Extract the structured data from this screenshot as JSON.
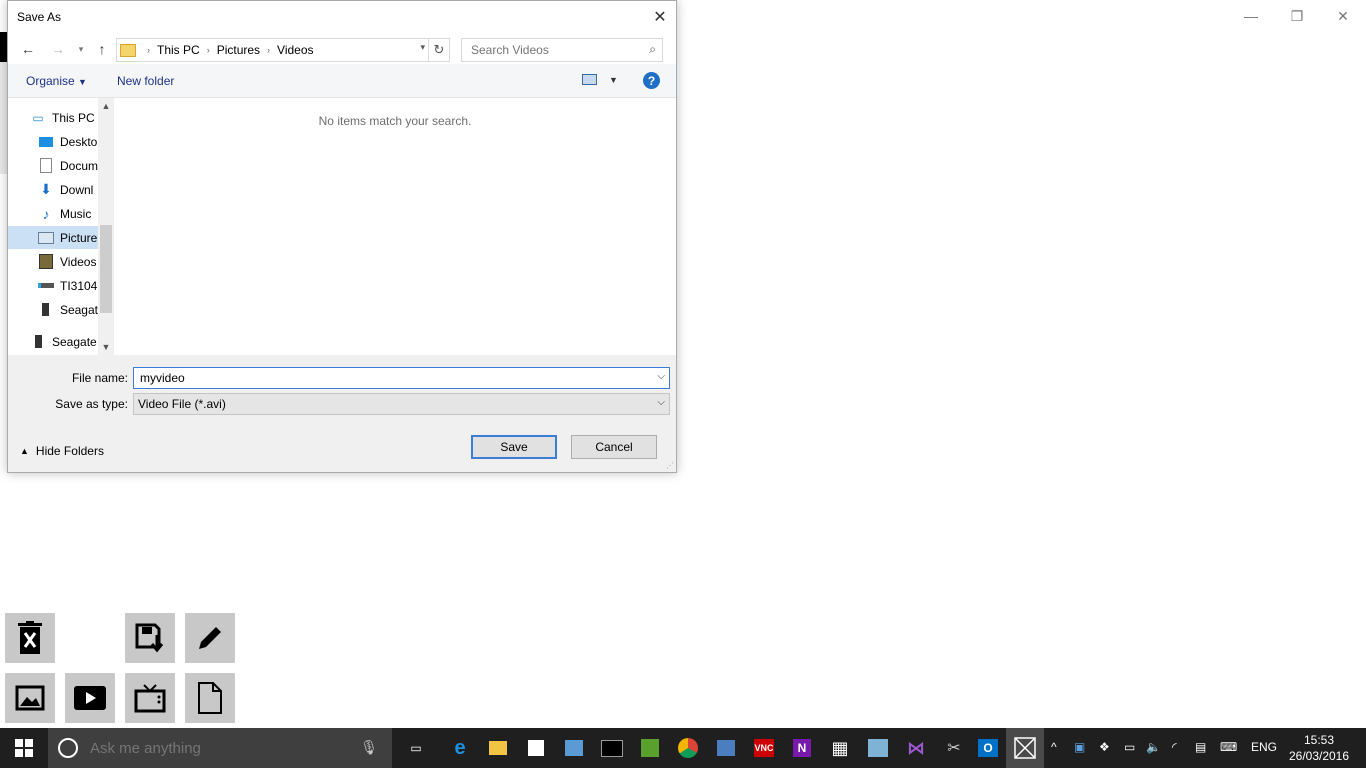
{
  "dialog": {
    "title": "Save As",
    "breadcrumb": [
      "This PC",
      "Pictures",
      "Videos"
    ],
    "search_placeholder": "Search Videos",
    "toolbar": {
      "organise": "Organise",
      "new_folder": "New folder"
    },
    "nav_items": [
      {
        "label": "This PC",
        "icon": "computer-icon"
      },
      {
        "label": "Deskto",
        "icon": "desktop-icon"
      },
      {
        "label": "Docum",
        "icon": "documents-icon"
      },
      {
        "label": "Downl",
        "icon": "downloads-icon"
      },
      {
        "label": "Music",
        "icon": "music-icon"
      },
      {
        "label": "Picture",
        "icon": "pictures-icon",
        "selected": true
      },
      {
        "label": "Videos",
        "icon": "videos-icon"
      },
      {
        "label": "TI3104",
        "icon": "drive-icon"
      },
      {
        "label": "Seagat",
        "icon": "external-drive-icon"
      },
      {
        "label": "Seagate",
        "icon": "external-drive-icon"
      }
    ],
    "empty_message": "No items match your search.",
    "file_name_label": "File name:",
    "file_name_value": "myvideo",
    "save_type_label": "Save as type:",
    "save_type_value": "Video File (*.avi)",
    "hide_folders": "Hide Folders",
    "save_button": "Save",
    "cancel_button": "Cancel"
  },
  "tool_tiles": [
    "delete-icon",
    "save-download-icon",
    "pencil-icon",
    "image-icon",
    "play-video-icon",
    "tv-icon",
    "document-icon"
  ],
  "taskbar": {
    "search_placeholder": "Ask me anything",
    "language": "ENG",
    "time": "15:53",
    "date": "26/03/2016"
  }
}
